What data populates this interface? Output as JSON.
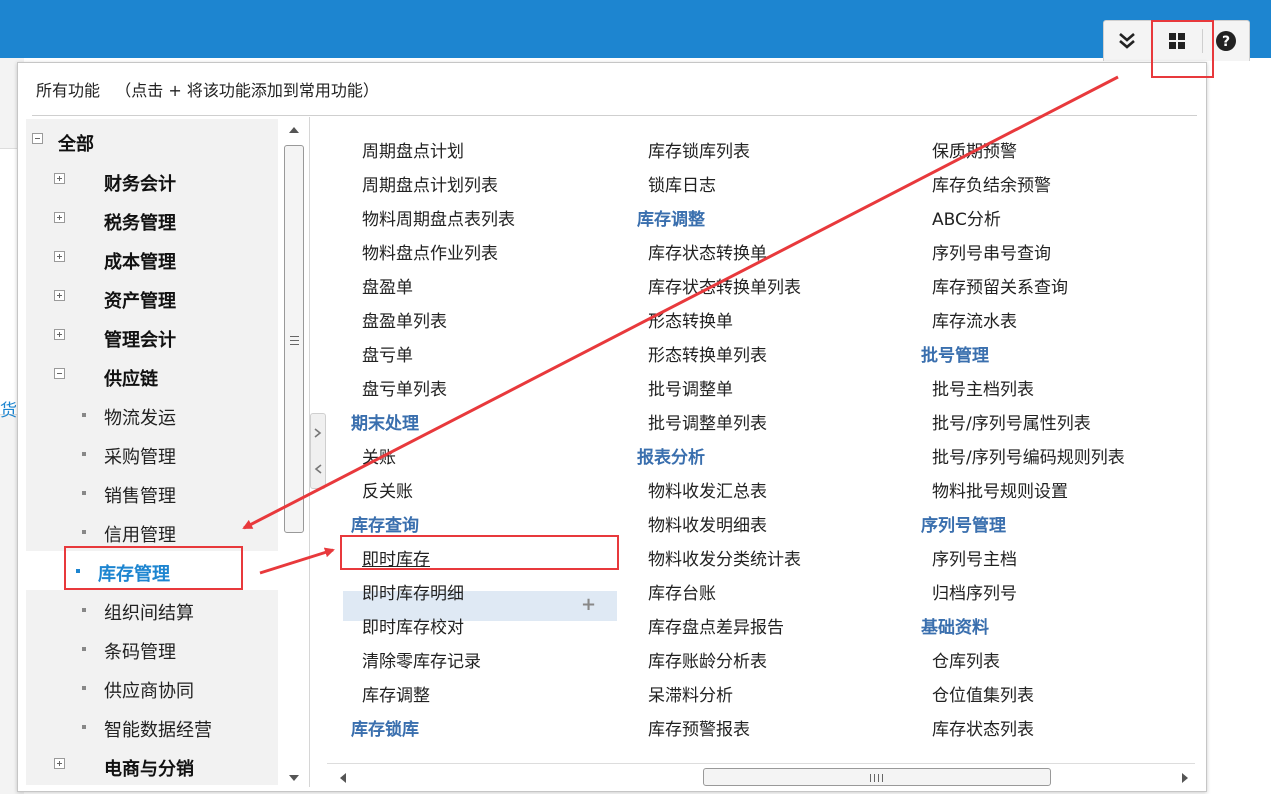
{
  "toolbar": {
    "buttons": [
      {
        "name": "collapse-all-icon",
        "glyph": "double-chevron-down"
      },
      {
        "name": "all-functions-icon",
        "glyph": "grid-four"
      },
      {
        "name": "help-icon",
        "glyph": "?"
      }
    ]
  },
  "background": {
    "side_text": "货"
  },
  "dialog": {
    "title": "所有功能   （点击 + 将该功能添加到常用功能）"
  },
  "tree": {
    "items": [
      {
        "label": "全部",
        "level": 0,
        "expanded": true
      },
      {
        "label": "财务会计",
        "level": 1,
        "expanded": false
      },
      {
        "label": "税务管理",
        "level": 1,
        "expanded": false
      },
      {
        "label": "成本管理",
        "level": 1,
        "expanded": false
      },
      {
        "label": "资产管理",
        "level": 1,
        "expanded": false
      },
      {
        "label": "管理会计",
        "level": 1,
        "expanded": false
      },
      {
        "label": "供应链",
        "level": 1,
        "expanded": true
      },
      {
        "label": "物流发运",
        "level": 2
      },
      {
        "label": "采购管理",
        "level": 2
      },
      {
        "label": "销售管理",
        "level": 2
      },
      {
        "label": "信用管理",
        "level": 2
      },
      {
        "label": "库存管理",
        "level": 2,
        "selected": true
      },
      {
        "label": "组织间结算",
        "level": 2
      },
      {
        "label": "条码管理",
        "level": 2
      },
      {
        "label": "供应商协同",
        "level": 2
      },
      {
        "label": "智能数据经营",
        "level": 2
      },
      {
        "label": "电商与分销",
        "level": 1,
        "expanded": false
      }
    ]
  },
  "columns": {
    "col1": [
      {
        "type": "item",
        "text": "周期盘点计划"
      },
      {
        "type": "item",
        "text": "周期盘点计划列表"
      },
      {
        "type": "item",
        "text": "物料周期盘点表列表"
      },
      {
        "type": "item",
        "text": "物料盘点作业列表"
      },
      {
        "type": "item",
        "text": "盘盈单"
      },
      {
        "type": "item",
        "text": "盘盈单列表"
      },
      {
        "type": "item",
        "text": "盘亏单"
      },
      {
        "type": "item",
        "text": "盘亏单列表"
      },
      {
        "type": "head",
        "text": "期末处理"
      },
      {
        "type": "item",
        "text": "关账"
      },
      {
        "type": "item",
        "text": "反关账"
      },
      {
        "type": "head",
        "text": "库存查询"
      },
      {
        "type": "item",
        "text": "即时库存",
        "highlighted": true
      },
      {
        "type": "item",
        "text": "即时库存明细"
      },
      {
        "type": "item",
        "text": "即时库存校对"
      },
      {
        "type": "item",
        "text": "清除零库存记录"
      },
      {
        "type": "item",
        "text": "库存调整"
      },
      {
        "type": "head",
        "text": "库存锁库"
      }
    ],
    "col2": [
      {
        "type": "item",
        "text": "库存锁库列表"
      },
      {
        "type": "item",
        "text": "锁库日志"
      },
      {
        "type": "head",
        "text": "库存调整"
      },
      {
        "type": "item",
        "text": "库存状态转换单"
      },
      {
        "type": "item",
        "text": "库存状态转换单列表"
      },
      {
        "type": "item",
        "text": "形态转换单"
      },
      {
        "type": "item",
        "text": "形态转换单列表"
      },
      {
        "type": "item",
        "text": "批号调整单"
      },
      {
        "type": "item",
        "text": "批号调整单列表"
      },
      {
        "type": "head",
        "text": "报表分析"
      },
      {
        "type": "item",
        "text": "物料收发汇总表"
      },
      {
        "type": "item",
        "text": "物料收发明细表"
      },
      {
        "type": "item",
        "text": "物料收发分类统计表"
      },
      {
        "type": "item",
        "text": "库存台账"
      },
      {
        "type": "item",
        "text": "库存盘点差异报告"
      },
      {
        "type": "item",
        "text": "库存账龄分析表"
      },
      {
        "type": "item",
        "text": "呆滞料分析"
      },
      {
        "type": "item",
        "text": "库存预警报表"
      }
    ],
    "col3": [
      {
        "type": "item",
        "text": "保质期预警"
      },
      {
        "type": "item",
        "text": "库存负结余预警"
      },
      {
        "type": "item",
        "text": "ABC分析"
      },
      {
        "type": "item",
        "text": "序列号串号查询"
      },
      {
        "type": "item",
        "text": "库存预留关系查询"
      },
      {
        "type": "item",
        "text": "库存流水表"
      },
      {
        "type": "head",
        "text": "批号管理"
      },
      {
        "type": "item",
        "text": "批号主档列表"
      },
      {
        "type": "item",
        "text": "批号/序列号属性列表"
      },
      {
        "type": "item",
        "text": "批号/序列号编码规则列表"
      },
      {
        "type": "item",
        "text": "物料批号规则设置"
      },
      {
        "type": "head",
        "text": "序列号管理"
      },
      {
        "type": "item",
        "text": "序列号主档"
      },
      {
        "type": "item",
        "text": "归档序列号"
      },
      {
        "type": "head",
        "text": "基础资料"
      },
      {
        "type": "item",
        "text": "仓库列表"
      },
      {
        "type": "item",
        "text": "仓位值集列表"
      },
      {
        "type": "item",
        "text": "库存状态列表"
      }
    ]
  },
  "add_icon": "+",
  "colors": {
    "topbar": "#1d85d0",
    "heading": "#3a6fae",
    "selected": "#1d85d0",
    "annotation": "#e8393c"
  }
}
